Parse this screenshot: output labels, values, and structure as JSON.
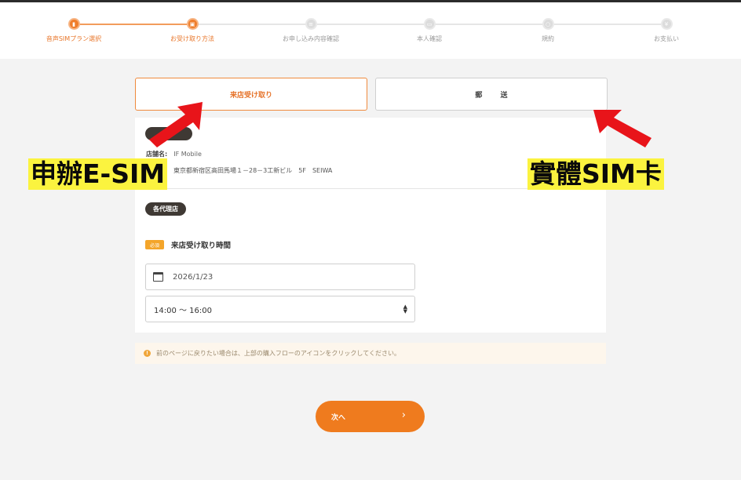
{
  "stepper": {
    "steps": [
      {
        "label": "音声SIMプラン選択",
        "state": "done"
      },
      {
        "label": "お受け取り方法",
        "state": "active"
      },
      {
        "label": "お申し込み内容確認",
        "state": "todo"
      },
      {
        "label": "本人確認",
        "state": "todo"
      },
      {
        "label": "規約",
        "state": "todo"
      },
      {
        "label": "お支払い",
        "state": "todo"
      }
    ]
  },
  "tabs": {
    "store_label": "来店受け取り",
    "mail_label": "郵 送"
  },
  "store": {
    "shop_name_label": "店舗名:",
    "shop_name": "IF Mobile",
    "address": "東京都新宿区高田馬場１－28－3工新ビル　5F　SEIWA",
    "agent_label": "各代理店"
  },
  "form": {
    "required_badge": "必須",
    "field_title": "来店受け取り時間",
    "date_value": "2026/1/23",
    "time_value": "14:00 ～ 16:00"
  },
  "notice": {
    "text": "前のページに戻りたい場合は、上部の購入フローのアイコンをクリックしてください。"
  },
  "next_button": {
    "label": "次へ",
    "chevron": "›"
  },
  "annotations": {
    "esim": "申辦E-SIM",
    "physical_sim": "實體SIM卡",
    "arrow_color": "#e8141a",
    "highlight_color": "#fbf33f"
  },
  "colors": {
    "accent": "#ef7b1e",
    "pill": "#3f3934",
    "required": "#f4a52a"
  }
}
